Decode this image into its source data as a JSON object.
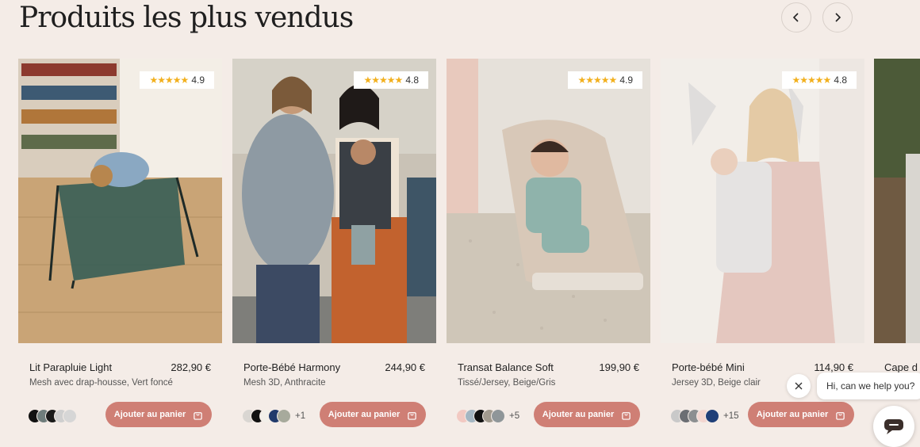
{
  "section": {
    "title": "Produits les plus vendus",
    "prev_icon": "chevron-left-icon",
    "next_icon": "chevron-right-icon"
  },
  "products": [
    {
      "name": "Lit Parapluie Light",
      "price": "282,90 €",
      "description": "Mesh avec drap-housse, Vert foncé",
      "rating": "4.9",
      "rating_stars": "★★★★★",
      "swatches": [
        "#111111",
        "#6f7d7c",
        "#1a1a1a",
        "#cfcfcf",
        "#d6d6d6"
      ],
      "more_colors": "",
      "button": "Ajouter au panier"
    },
    {
      "name": "Porte-Bébé Harmony",
      "price": "244,90 €",
      "description": "Mesh 3D, Anthracite",
      "rating": "4.8",
      "rating_stars": "★★★★★",
      "swatches": [
        "#d9d6d2",
        "#111111",
        "#f2efe9",
        "#213a6b",
        "#a7aa9c"
      ],
      "more_colors": "+1",
      "button": "Ajouter au panier"
    },
    {
      "name": "Transat Balance Soft",
      "price": "199,90 €",
      "description": "Tissé/Jersey, Beige/Gris",
      "rating": "4.9",
      "rating_stars": "★★★★★",
      "swatches": [
        "#f2c9c2",
        "#a4b6c2",
        "#111111",
        "#a19a8e",
        "#8f9699"
      ],
      "more_colors": "+5",
      "button": "Ajouter au panier"
    },
    {
      "name": "Porte-bébé Mini",
      "price": "114,90 €",
      "description": "Jersey 3D, Beige clair",
      "rating": "4.8",
      "rating_stars": "★★★★★",
      "swatches": [
        "#c9c9c9",
        "#6b6e73",
        "#8c8f91",
        "#f3d6d0",
        "#1f3f78"
      ],
      "more_colors": "+15",
      "button": "Ajouter au panier"
    }
  ],
  "peek_product": {
    "name": "Cape d"
  },
  "chat": {
    "prompt": "Hi, can we help you?",
    "close_icon": "close-icon",
    "launcher_icon": "chat-icon"
  },
  "colors": {
    "accent": "#cf7f75",
    "background": "#f4ece7",
    "star": "#f2b01e"
  }
}
